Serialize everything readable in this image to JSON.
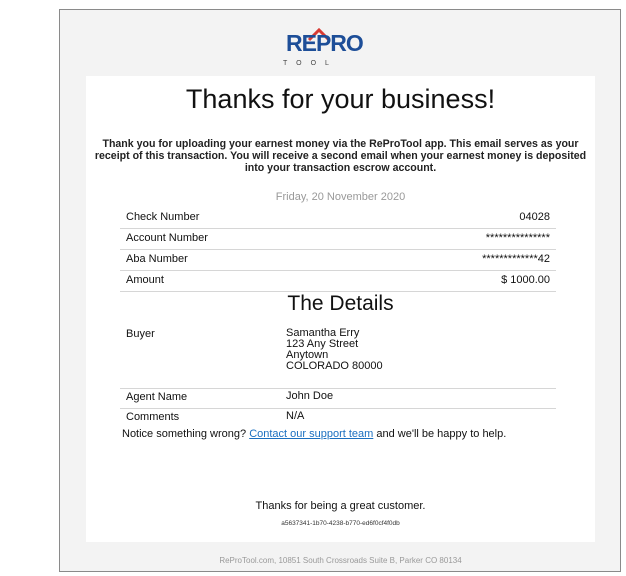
{
  "brand": {
    "wordmark": "REPRO",
    "tagline": "TOOL",
    "primary_color": "#1d4e98",
    "accent_color": "#d83a34"
  },
  "heading": "Thanks for your business!",
  "intro": "Thank you for uploading your earnest money via the ReProTool app. This email serves as your receipt of this transaction. You will receive a second email when your earnest money is deposited into your transaction escrow account.",
  "date": "Friday, 20 November 2020",
  "receipt": {
    "rows": [
      {
        "label": "Check Number",
        "value": "04028"
      },
      {
        "label": "Account Number",
        "value": "***************"
      },
      {
        "label": "Aba Number",
        "value": "*************42"
      },
      {
        "label": "Amount",
        "value": "$ 1000.00"
      }
    ]
  },
  "details": {
    "title": "The Details",
    "buyer_label": "Buyer",
    "buyer_lines": [
      "Samantha Erry",
      "123 Any Street",
      "Anytown",
      "COLORADO 80000"
    ],
    "agent_label": "Agent Name",
    "agent_value": "John Doe",
    "comments_label": "Comments",
    "comments_value": "N/A"
  },
  "notice": {
    "prefix": "Notice something wrong?",
    "link": "Contact our support team",
    "suffix": "and we'll be happy to help."
  },
  "closing": "Thanks for being a great customer.",
  "guid": "a5637341-1b70-4238-b770-ed6f0cf4f0db",
  "footer": "ReProTool.com, 10851 South Crossroads Suite B, Parker CO 80134"
}
